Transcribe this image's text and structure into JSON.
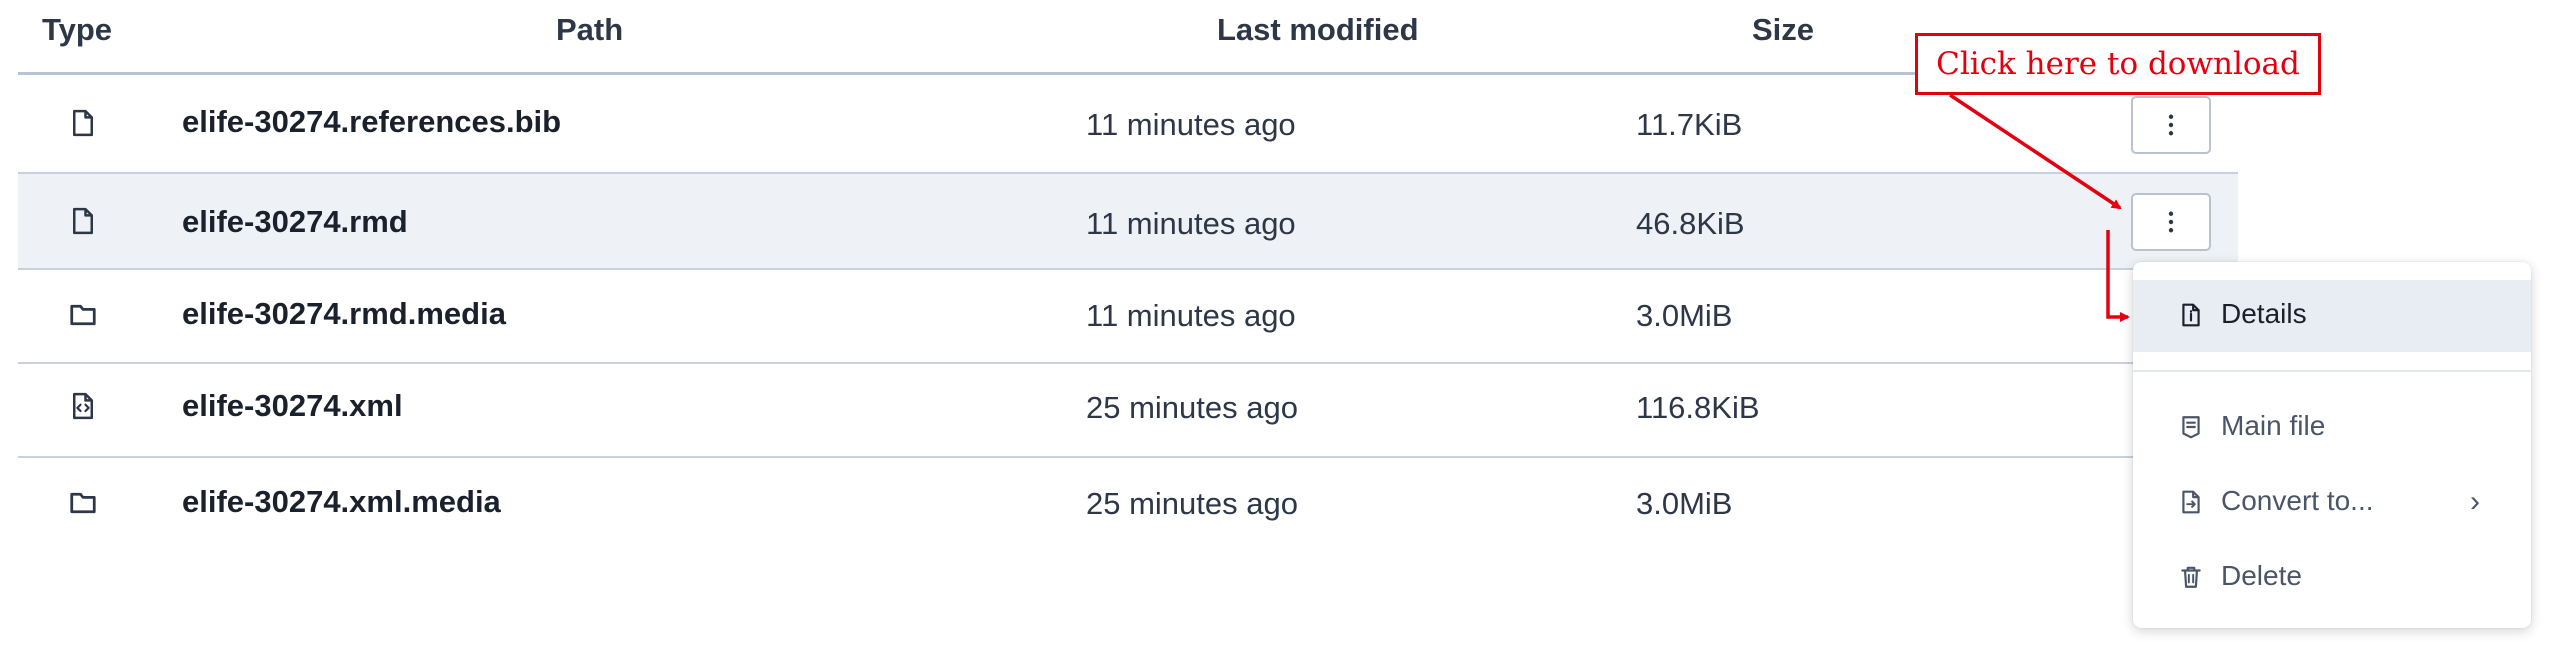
{
  "table": {
    "headers": {
      "type": "Type",
      "path": "Path",
      "modified": "Last modified",
      "size": "Size"
    },
    "rows": [
      {
        "icon": "file-icon",
        "path": "elife-30274.references.bib",
        "modified": "11 minutes ago",
        "size": "11.7KiB"
      },
      {
        "icon": "file-icon",
        "path": "elife-30274.rmd",
        "modified": "11 minutes ago",
        "size": "46.8KiB"
      },
      {
        "icon": "folder-icon",
        "path": "elife-30274.rmd.media",
        "modified": "11 minutes ago",
        "size": "3.0MiB"
      },
      {
        "icon": "code-file-icon",
        "path": "elife-30274.xml",
        "modified": "25 minutes ago",
        "size": "116.8KiB"
      },
      {
        "icon": "folder-icon",
        "path": "elife-30274.xml.media",
        "modified": "25 minutes ago",
        "size": "3.0MiB"
      }
    ]
  },
  "menu": {
    "items": [
      {
        "label": "Details",
        "icon": "file-info-icon"
      },
      {
        "label": "Main file",
        "icon": "main-file-icon"
      },
      {
        "label": "Convert to...",
        "icon": "convert-icon"
      },
      {
        "label": "Delete",
        "icon": "trash-icon"
      }
    ]
  },
  "annotation": {
    "text": "Click here to download"
  },
  "colors": {
    "annotation": "#e3000f",
    "row_highlight": "#eef2f6",
    "menu_active": "#e7edf3"
  }
}
